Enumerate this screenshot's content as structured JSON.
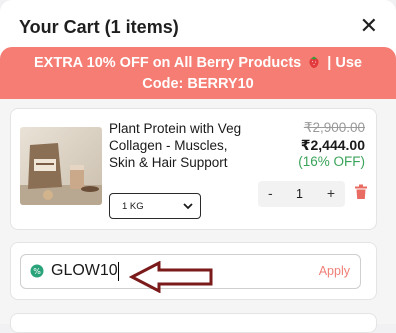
{
  "header": {
    "title": "Your Cart (1 items)",
    "close_icon": "close-icon"
  },
  "promo": {
    "line1": "EXTRA 10% OFF on All Berry Products",
    "separator": "| Use",
    "line2": "Code: BERRY10",
    "icon": "strawberry-icon"
  },
  "cart": {
    "item": {
      "name": "Plant Protein with Veg Collagen - Muscles, Skin & Hair Support",
      "mrp": "₹2,900.00",
      "price": "₹2,444.00",
      "discount": "(16% OFF)",
      "size": "1 KG",
      "quantity": "1",
      "minus": "-",
      "plus": "+"
    }
  },
  "coupon": {
    "value": "GLOW10",
    "apply_label": "Apply"
  },
  "colors": {
    "promo_bg": "#f57d73",
    "discount": "#3aa35a",
    "apply": "#f08077",
    "trash": "#e96c62",
    "annotation_arrow": "#7a1a1a"
  }
}
